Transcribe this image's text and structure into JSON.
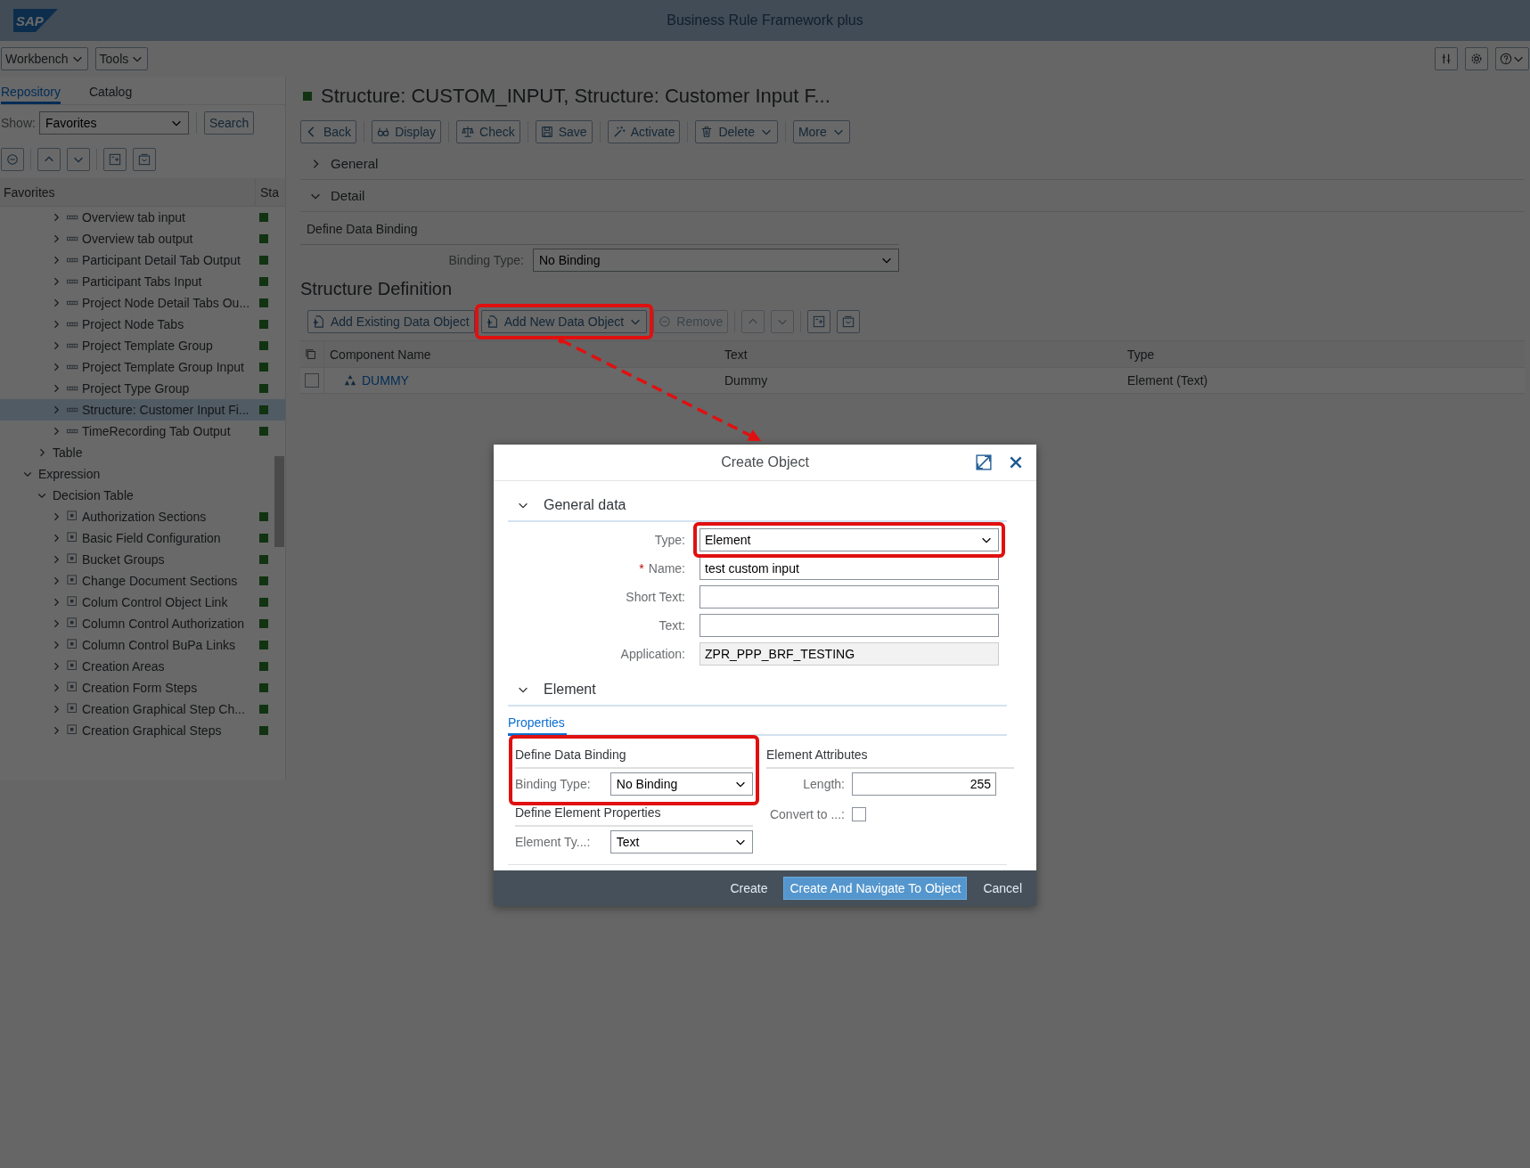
{
  "shell": {
    "logo": "SAP",
    "title": "Business Rule Framework plus"
  },
  "menus": [
    {
      "label": "Workbench"
    },
    {
      "label": "Tools"
    }
  ],
  "left": {
    "tabs": [
      {
        "label": "Repository",
        "selected": true
      },
      {
        "label": "Catalog",
        "selected": false
      }
    ],
    "show_label": "Show:",
    "show_value": "Favorites",
    "search_button": "Search",
    "tree_columns": [
      "Favorites",
      "Sta"
    ],
    "tree": [
      {
        "children": [
          {
            "children": [
              {
                "label": "Overview tab input",
                "kind": "structure",
                "expanded": false,
                "active": true,
                "selected": false
              },
              {
                "label": "Overview tab output",
                "kind": "structure",
                "expanded": false,
                "active": true,
                "selected": false
              },
              {
                "label": "Participant Detail Tab Output",
                "kind": "structure",
                "expanded": false,
                "active": true,
                "selected": false
              },
              {
                "label": "Participant Tabs Input",
                "kind": "structure",
                "expanded": false,
                "active": true,
                "selected": false
              },
              {
                "label": "Project Node Detail Tabs Ou...",
                "kind": "structure",
                "expanded": false,
                "active": true,
                "selected": false
              },
              {
                "label": "Project Node Tabs",
                "kind": "structure",
                "expanded": false,
                "active": true,
                "selected": false
              },
              {
                "label": "Project Template Group",
                "kind": "structure",
                "expanded": false,
                "active": true,
                "selected": false
              },
              {
                "label": "Project Template Group Input",
                "kind": "structure",
                "expanded": false,
                "active": true,
                "selected": false
              },
              {
                "label": "Project Type Group",
                "kind": "structure",
                "expanded": false,
                "active": true,
                "selected": false
              },
              {
                "label": "Structure: Customer Input Fi...",
                "kind": "structure",
                "expanded": false,
                "active": true,
                "selected": true
              },
              {
                "label": "TimeRecording Tab Output",
                "kind": "structure",
                "expanded": false,
                "active": true,
                "selected": false
              }
            ]
          },
          {
            "label": "Table",
            "expanded": false,
            "selected": false
          }
        ]
      },
      {
        "label": "Expression",
        "expanded": true,
        "selected": false,
        "children": [
          {
            "label": "Decision Table",
            "expanded": true,
            "selected": false,
            "children": [
              {
                "label": "Authorization Sections",
                "kind": "decision_table",
                "expanded": false,
                "active": true,
                "selected": false
              },
              {
                "label": "Basic Field Configuration",
                "kind": "decision_table",
                "expanded": false,
                "active": true,
                "selected": false
              },
              {
                "label": "Bucket Groups",
                "kind": "decision_table",
                "expanded": false,
                "active": true,
                "selected": false
              },
              {
                "label": "Change Document Sections",
                "kind": "decision_table",
                "expanded": false,
                "active": true,
                "selected": false
              },
              {
                "label": "Colum Control Object Link",
                "kind": "decision_table",
                "expanded": false,
                "active": true,
                "selected": false
              },
              {
                "label": "Column Control Authorization",
                "kind": "decision_table",
                "expanded": false,
                "active": true,
                "selected": false
              },
              {
                "label": "Column Control BuPa Links",
                "kind": "decision_table",
                "expanded": false,
                "active": true,
                "selected": false
              },
              {
                "label": "Creation Areas",
                "kind": "decision_table",
                "expanded": false,
                "active": true,
                "selected": false
              },
              {
                "label": "Creation Form Steps",
                "kind": "decision_table",
                "expanded": false,
                "active": true,
                "selected": false
              },
              {
                "label": "Creation Graphical Step Ch...",
                "kind": "decision_table",
                "expanded": false,
                "active": true,
                "selected": false
              },
              {
                "label": "Creation Graphical Steps",
                "kind": "decision_table",
                "expanded": false,
                "active": true,
                "selected": false
              }
            ]
          }
        ]
      }
    ]
  },
  "object": {
    "title": "Structure: CUSTOM_INPUT, Structure: Customer Input F...",
    "active": true,
    "toolbar": [
      {
        "label": "Back",
        "menu": false
      },
      {
        "label": "Display",
        "menu": false
      },
      {
        "label": "Check",
        "menu": false
      },
      {
        "label": "Save",
        "menu": false
      },
      {
        "label": "Activate",
        "menu": false
      },
      {
        "label": "Delete",
        "menu": true
      },
      {
        "label": "More",
        "menu": true
      }
    ],
    "panels": [
      {
        "label": "General",
        "expanded": false
      },
      {
        "label": "Detail",
        "expanded": true
      }
    ],
    "binding_heading": "Define Data Binding",
    "binding_label": "Binding Type:",
    "binding_value": "No Binding",
    "structure_heading": "Structure Definition",
    "structure_toolbar": [
      {
        "label": "Add Existing Data Object",
        "menu": false,
        "disabled": false,
        "highlighted": false
      },
      {
        "label": "Add New Data Object",
        "menu": true,
        "disabled": false,
        "highlighted": true
      },
      {
        "label": "Remove",
        "menu": false,
        "disabled": true,
        "highlighted": false
      }
    ],
    "table": {
      "columns": [
        "Component Name",
        "Text",
        "Type"
      ],
      "rows": [
        {
          "selected": false,
          "cells": [
            "DUMMY",
            "Dummy",
            "Element (Text)"
          ]
        }
      ]
    }
  },
  "dialog": {
    "title": "Create Object",
    "required_mark": "*",
    "general": {
      "label": "General data",
      "expanded": true,
      "fields": [
        {
          "label": "Type:",
          "kind": "select",
          "value": "Element",
          "required": false,
          "highlighted": true
        },
        {
          "label": "Name:",
          "kind": "input",
          "value": "test custom input",
          "required": true,
          "highlighted": false
        },
        {
          "label": "Short Text:",
          "kind": "input",
          "required": false,
          "highlighted": false
        },
        {
          "label": "Text:",
          "kind": "input",
          "required": false,
          "highlighted": false
        },
        {
          "label": "Application:",
          "kind": "readonly",
          "value": "ZPR_PPP_BRF_TESTING",
          "required": false,
          "highlighted": false
        }
      ]
    },
    "element": {
      "label": "Element",
      "expanded": true,
      "tabs": [
        {
          "label": "Properties",
          "selected": true
        }
      ],
      "binding": {
        "heading": "Define Data Binding",
        "label": "Binding Type:",
        "value": "No Binding",
        "highlighted": true
      },
      "properties": {
        "heading": "Define Element Properties",
        "label": "Element Ty...:",
        "value": "Text"
      },
      "attributes": {
        "heading": "Element Attributes",
        "length_label": "Length:",
        "length_value": "255",
        "convert_label": "Convert to ...:",
        "convert_checked": false
      }
    },
    "buttons": [
      {
        "label": "Create",
        "emphasized": false
      },
      {
        "label": "Create And Navigate To Object",
        "emphasized": true
      },
      {
        "label": "Cancel",
        "emphasized": false
      }
    ]
  },
  "annotations": {
    "arrow": true
  }
}
